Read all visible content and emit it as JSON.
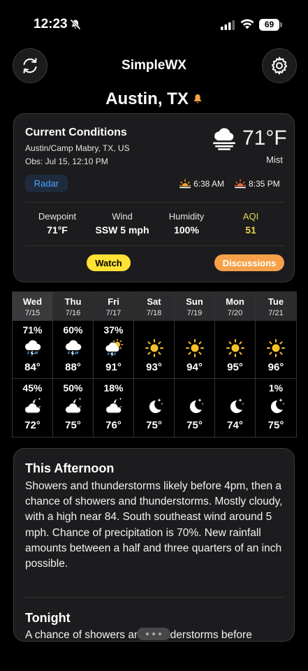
{
  "status_bar": {
    "time": "12:23",
    "battery": "69"
  },
  "header": {
    "title": "SimpleWX",
    "location": "Austin, TX"
  },
  "current": {
    "title": "Current Conditions",
    "station": "Austin/Camp Mabry, TX, US",
    "observed": "Obs: Jul 15, 12:10 PM",
    "temperature": "71°F",
    "description": "Mist",
    "radar_label": "Radar",
    "sunrise": "6:38 AM",
    "sunset": "8:35 PM",
    "metrics": [
      {
        "label": "Dewpoint",
        "value": "71°F"
      },
      {
        "label": "Wind",
        "value": "SSW 5 mph"
      },
      {
        "label": "Humidity",
        "value": "100%"
      },
      {
        "label": "AQI",
        "value": "51"
      }
    ],
    "watch_label": "Watch",
    "discussions_label": "Discussions"
  },
  "colors": {
    "aqi": "#e3d64a",
    "watch": "#ffe234",
    "discussions": "#f6a14a",
    "radar": "#4aa3ff",
    "alert": "#f6a14a"
  },
  "forecast": [
    {
      "day": "Wed",
      "date": "7/15",
      "day_pct": "71%",
      "day_icon": "thunderstorm-icon",
      "high": "84°",
      "night_pct": "45%",
      "night_icon": "partly-cloudy-night-icon",
      "low": "72°"
    },
    {
      "day": "Thu",
      "date": "7/16",
      "day_pct": "60%",
      "day_icon": "thunderstorm-icon",
      "high": "88°",
      "night_pct": "50%",
      "night_icon": "partly-cloudy-night-icon",
      "low": "75°"
    },
    {
      "day": "Fri",
      "date": "7/17",
      "day_pct": "37%",
      "day_icon": "sun-thunderstorm-icon",
      "high": "91°",
      "night_pct": "18%",
      "night_icon": "partly-cloudy-night-icon",
      "low": "76°"
    },
    {
      "day": "Sat",
      "date": "7/18",
      "day_pct": "",
      "day_icon": "sun-icon",
      "high": "93°",
      "night_pct": "",
      "night_icon": "moon-icon",
      "low": "75°"
    },
    {
      "day": "Sun",
      "date": "7/19",
      "day_pct": "",
      "day_icon": "sun-icon",
      "high": "94°",
      "night_pct": "",
      "night_icon": "moon-icon",
      "low": "75°"
    },
    {
      "day": "Mon",
      "date": "7/20",
      "day_pct": "",
      "day_icon": "sun-icon",
      "high": "95°",
      "night_pct": "",
      "night_icon": "moon-icon",
      "low": "74°"
    },
    {
      "day": "Tue",
      "date": "7/21",
      "day_pct": "",
      "day_icon": "sun-icon",
      "high": "96°",
      "night_pct": "1%",
      "night_icon": "moon-icon",
      "low": "75°"
    }
  ],
  "periods": [
    {
      "name": "This Afternoon",
      "text": "Showers and thunderstorms likely before 4pm, then a chance of showers and thunderstorms. Mostly cloudy, with a high near 84. South southeast wind around 5 mph. Chance of precipitation is 70%. New rainfall amounts between a half and three quarters of an inch possible."
    },
    {
      "name": "Tonight",
      "text": "A chance of showers and thunderstorms before"
    }
  ]
}
